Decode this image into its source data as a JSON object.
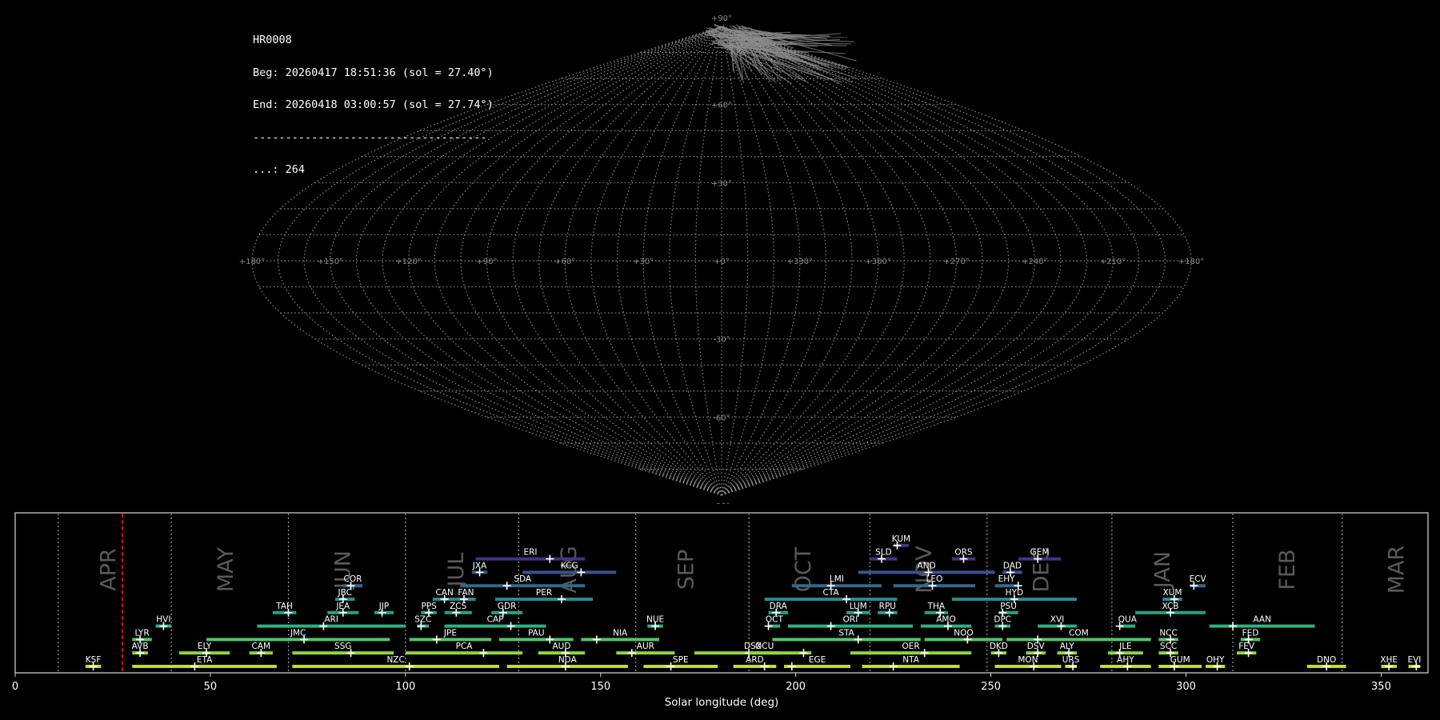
{
  "info": {
    "station": "HR0008",
    "begin": "Beg: 20260417 18:51:36 (sol = 27.40°)",
    "end": "End: 20260418 03:00:57 (sol = 27.74°)",
    "separator": "------------------------------------",
    "count": "...: 264"
  },
  "sky_chart": {
    "type": "sinusoidal-projection-map",
    "lon_labels": [
      "+180°",
      "+150°",
      "+120°",
      "+90°",
      "+60°",
      "+30°",
      "+0°",
      "+330°",
      "+300°",
      "+270°",
      "+240°",
      "+210°",
      "+180°"
    ],
    "lat_labels": [
      "+90°",
      "+60°",
      "+30°",
      "-30°",
      "-60°",
      "-90°"
    ],
    "grid_color": "#8c8c8c",
    "trail_color": "#8c8c8c",
    "meteor_count": 264
  },
  "chart_data": {
    "type": "timeline",
    "xlabel": "Solar longitude (deg)",
    "xlim": [
      0,
      362
    ],
    "xticks": [
      0,
      50,
      100,
      150,
      200,
      250,
      300,
      350
    ],
    "current_sol": 27.5,
    "current_line_color": "#ff0000",
    "month_boundaries": [
      11,
      40,
      70,
      100,
      129,
      159,
      188,
      219,
      249,
      281,
      312,
      340
    ],
    "months": [
      {
        "name": "APR",
        "sol": 24
      },
      {
        "name": "MAY",
        "sol": 54
      },
      {
        "name": "JUN",
        "sol": 84
      },
      {
        "name": "JUL",
        "sol": 113
      },
      {
        "name": "AUG",
        "sol": 142
      },
      {
        "name": "SEP",
        "sol": 172
      },
      {
        "name": "OCT",
        "sol": 202
      },
      {
        "name": "NOV",
        "sol": 233
      },
      {
        "name": "DEC",
        "sol": 263
      },
      {
        "name": "JAN",
        "sol": 294
      },
      {
        "name": "FEB",
        "sol": 326
      },
      {
        "name": "MAR",
        "sol": 354
      }
    ],
    "level_colors": [
      "#c8dc28",
      "#90d43c",
      "#54c468",
      "#30b080",
      "#24a088",
      "#2a8a8c",
      "#31688e",
      "#3b528b",
      "#46327e"
    ],
    "showers": [
      {
        "code": "KSF",
        "start": 18,
        "end": 22,
        "peak": 20,
        "level": 0
      },
      {
        "code": "ETA",
        "start": 30,
        "end": 67,
        "peak": 46,
        "level": 0
      },
      {
        "code": "NZC",
        "start": 71,
        "end": 124,
        "peak": 101,
        "level": 0
      },
      {
        "code": "NDA",
        "start": 126,
        "end": 157,
        "peak": 141,
        "level": 0
      },
      {
        "code": "SPE",
        "start": 161,
        "end": 180,
        "peak": 168,
        "level": 0
      },
      {
        "code": "ARD",
        "start": 184,
        "end": 195,
        "peak": 192,
        "level": 0
      },
      {
        "code": "EGE",
        "start": 197,
        "end": 214,
        "peak": 199,
        "level": 0
      },
      {
        "code": "NTA",
        "start": 217,
        "end": 242,
        "peak": 225,
        "level": 0
      },
      {
        "code": "MON",
        "start": 251,
        "end": 268,
        "peak": 261,
        "level": 0
      },
      {
        "code": "URS",
        "start": 269,
        "end": 272,
        "peak": 271,
        "level": 0
      },
      {
        "code": "AHY",
        "start": 278,
        "end": 291,
        "peak": 285,
        "level": 0
      },
      {
        "code": "GUM",
        "start": 293,
        "end": 304,
        "peak": 297,
        "level": 0
      },
      {
        "code": "OHY",
        "start": 305,
        "end": 310,
        "peak": 308,
        "level": 0
      },
      {
        "code": "DNO",
        "start": 331,
        "end": 341,
        "peak": 336,
        "level": 0
      },
      {
        "code": "XHE",
        "start": 350,
        "end": 354,
        "peak": 352,
        "level": 0
      },
      {
        "code": "EVI",
        "start": 357,
        "end": 360,
        "peak": 359,
        "level": 0
      },
      {
        "code": "AVB",
        "start": 30,
        "end": 34,
        "peak": 32,
        "level": 1
      },
      {
        "code": "ELY",
        "start": 42,
        "end": 55,
        "peak": 49,
        "level": 1
      },
      {
        "code": "CAM",
        "start": 60,
        "end": 66,
        "peak": 63,
        "level": 1
      },
      {
        "code": "SSG",
        "start": 71,
        "end": 97,
        "peak": 86,
        "level": 1
      },
      {
        "code": "PCA",
        "start": 100,
        "end": 130,
        "peak": 120,
        "level": 1
      },
      {
        "code": "AUD",
        "start": 134,
        "end": 146,
        "peak": 141,
        "level": 1
      },
      {
        "code": "AUR",
        "start": 154,
        "end": 169,
        "peak": 158,
        "level": 1
      },
      {
        "code": "DSX",
        "start": 174,
        "end": 204,
        "peak": 188,
        "level": 1
      },
      {
        "code": "OCU",
        "start": 188,
        "end": 196,
        "peak": 202,
        "level": 1
      },
      {
        "code": "OER",
        "start": 214,
        "end": 245,
        "peak": 233,
        "level": 1
      },
      {
        "code": "DKD",
        "start": 250,
        "end": 254,
        "peak": 252,
        "level": 1
      },
      {
        "code": "DSV",
        "start": 259,
        "end": 264,
        "peak": 262,
        "level": 1
      },
      {
        "code": "ALY",
        "start": 267,
        "end": 272,
        "peak": 270,
        "level": 1
      },
      {
        "code": "JLE",
        "start": 280,
        "end": 289,
        "peak": 283,
        "level": 1
      },
      {
        "code": "SCC",
        "start": 293,
        "end": 298,
        "peak": 296,
        "level": 1
      },
      {
        "code": "FEV",
        "start": 313,
        "end": 318,
        "peak": 316,
        "level": 1
      },
      {
        "code": "LYR",
        "start": 30,
        "end": 35,
        "peak": 32,
        "level": 2
      },
      {
        "code": "JMC",
        "start": 49,
        "end": 96,
        "peak": 74,
        "level": 2
      },
      {
        "code": "JPE",
        "start": 101,
        "end": 122,
        "peak": 108,
        "level": 2
      },
      {
        "code": "PAU",
        "start": 124,
        "end": 143,
        "peak": 137,
        "level": 2
      },
      {
        "code": "NIA",
        "start": 145,
        "end": 165,
        "peak": 149,
        "level": 2
      },
      {
        "code": "STA",
        "start": 194,
        "end": 232,
        "peak": 216,
        "level": 2
      },
      {
        "code": "NOO",
        "start": 233,
        "end": 253,
        "peak": 244,
        "level": 2
      },
      {
        "code": "COM",
        "start": 254,
        "end": 291,
        "peak": 262,
        "level": 2
      },
      {
        "code": "NCC",
        "start": 293,
        "end": 298,
        "peak": 296,
        "level": 2
      },
      {
        "code": "FED",
        "start": 314,
        "end": 319,
        "peak": 316,
        "level": 2
      },
      {
        "code": "HVI",
        "start": 36,
        "end": 40,
        "peak": 38,
        "level": 3
      },
      {
        "code": "ARI",
        "start": 62,
        "end": 100,
        "peak": 79,
        "level": 3
      },
      {
        "code": "SZC",
        "start": 103,
        "end": 106,
        "peak": 104,
        "level": 3
      },
      {
        "code": "CAP",
        "start": 110,
        "end": 136,
        "peak": 127,
        "level": 3
      },
      {
        "code": "NUE",
        "start": 162,
        "end": 166,
        "peak": 164,
        "level": 3
      },
      {
        "code": "OCT",
        "start": 193,
        "end": 196,
        "peak": 193,
        "level": 3
      },
      {
        "code": "ORI",
        "start": 198,
        "end": 230,
        "peak": 209,
        "level": 3
      },
      {
        "code": "AMO",
        "start": 232,
        "end": 245,
        "peak": 239,
        "level": 3
      },
      {
        "code": "DPC",
        "start": 251,
        "end": 255,
        "peak": 253,
        "level": 3
      },
      {
        "code": "XVI",
        "start": 262,
        "end": 272,
        "peak": 268,
        "level": 3
      },
      {
        "code": "QUA",
        "start": 283,
        "end": 287,
        "peak": 283,
        "level": 3
      },
      {
        "code": "AAN",
        "start": 306,
        "end": 333,
        "peak": 312,
        "level": 3
      },
      {
        "code": "TAH",
        "start": 66,
        "end": 72,
        "peak": 70,
        "level": 4
      },
      {
        "code": "JEA",
        "start": 80,
        "end": 88,
        "peak": 84,
        "level": 4
      },
      {
        "code": "JIP",
        "start": 92,
        "end": 97,
        "peak": 94,
        "level": 4
      },
      {
        "code": "PPS",
        "start": 104,
        "end": 108,
        "peak": 106,
        "level": 4
      },
      {
        "code": "ZCS",
        "start": 110,
        "end": 117,
        "peak": 113,
        "level": 4
      },
      {
        "code": "GDR",
        "start": 122,
        "end": 130,
        "peak": 125,
        "level": 4
      },
      {
        "code": "DRA",
        "start": 193,
        "end": 198,
        "peak": 195,
        "level": 4
      },
      {
        "code": "LUM",
        "start": 213,
        "end": 219,
        "peak": 216,
        "level": 4
      },
      {
        "code": "RPU",
        "start": 221,
        "end": 226,
        "peak": 224,
        "level": 4
      },
      {
        "code": "THA",
        "start": 233,
        "end": 239,
        "peak": 237,
        "level": 4
      },
      {
        "code": "PSU",
        "start": 252,
        "end": 257,
        "peak": 253,
        "level": 4
      },
      {
        "code": "XCB",
        "start": 287,
        "end": 305,
        "peak": 296,
        "level": 4
      },
      {
        "code": "JBC",
        "start": 82,
        "end": 87,
        "peak": 84,
        "level": 5
      },
      {
        "code": "CAN",
        "start": 107,
        "end": 113,
        "peak": 110,
        "level": 5
      },
      {
        "code": "FAN",
        "start": 113,
        "end": 118,
        "peak": 115,
        "level": 5
      },
      {
        "code": "PER",
        "start": 123,
        "end": 148,
        "peak": 140,
        "level": 5
      },
      {
        "code": "CTA",
        "start": 192,
        "end": 226,
        "peak": 213,
        "level": 5
      },
      {
        "code": "HYD",
        "start": 240,
        "end": 272,
        "peak": 256,
        "level": 5
      },
      {
        "code": "XUM",
        "start": 294,
        "end": 299,
        "peak": 297,
        "level": 5
      },
      {
        "code": "COR",
        "start": 84,
        "end": 89,
        "peak": 86,
        "level": 6
      },
      {
        "code": "SDA",
        "start": 114,
        "end": 146,
        "peak": 126,
        "level": 6
      },
      {
        "code": "LMI",
        "start": 199,
        "end": 222,
        "peak": 209,
        "level": 6
      },
      {
        "code": "LEO",
        "start": 225,
        "end": 246,
        "peak": 235,
        "level": 6
      },
      {
        "code": "EHY",
        "start": 251,
        "end": 257,
        "peak": 257,
        "level": 6
      },
      {
        "code": "ECV",
        "start": 301,
        "end": 305,
        "peak": 302,
        "level": 6
      },
      {
        "code": "JXA",
        "start": 117,
        "end": 121,
        "peak": 119,
        "level": 7
      },
      {
        "code": "KCG",
        "start": 130,
        "end": 154,
        "peak": 145,
        "level": 7
      },
      {
        "code": "AND",
        "start": 216,
        "end": 251,
        "peak": 234,
        "level": 7
      },
      {
        "code": "DAD",
        "start": 253,
        "end": 258,
        "peak": 255,
        "level": 7
      },
      {
        "code": "ERI",
        "start": 118,
        "end": 146,
        "peak": 137,
        "level": 8
      },
      {
        "code": "SLD",
        "start": 219,
        "end": 226,
        "peak": 222,
        "level": 8
      },
      {
        "code": "ORS",
        "start": 240,
        "end": 246,
        "peak": 243,
        "level": 8
      },
      {
        "code": "GEM",
        "start": 257,
        "end": 268,
        "peak": 262,
        "level": 8
      },
      {
        "code": "KUM",
        "start": 225,
        "end": 229,
        "peak": 226,
        "level": 9
      }
    ]
  }
}
